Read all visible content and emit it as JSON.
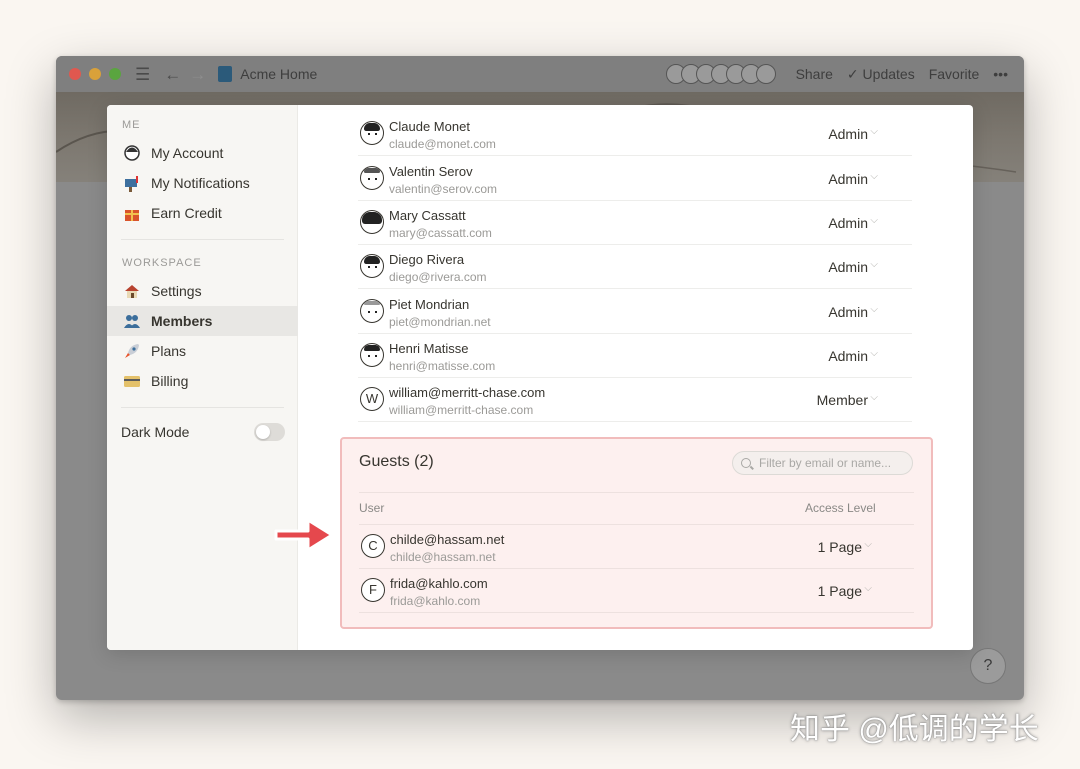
{
  "titlebar": {
    "page_title": "Acme Home",
    "share_label": "Share",
    "updates_label": "Updates",
    "favorite_label": "Favorite",
    "more_label": "•••"
  },
  "sidebar": {
    "me_label": "ME",
    "workspace_label": "WORKSPACE",
    "me_items": [
      {
        "label": "My Account",
        "icon": "account-icon"
      },
      {
        "label": "My Notifications",
        "icon": "mailbox-icon"
      },
      {
        "label": "Earn Credit",
        "icon": "gift-icon"
      }
    ],
    "workspace_items": [
      {
        "label": "Settings",
        "icon": "house-icon"
      },
      {
        "label": "Members",
        "icon": "people-icon",
        "active": true
      },
      {
        "label": "Plans",
        "icon": "rocket-icon"
      },
      {
        "label": "Billing",
        "icon": "credit-card-icon"
      }
    ],
    "dark_mode_label": "Dark Mode",
    "dark_mode_on": false
  },
  "members": [
    {
      "name": "Claude Monet",
      "email": "claude@monet.com",
      "role": "Admin"
    },
    {
      "name": "Valentin Serov",
      "email": "valentin@serov.com",
      "role": "Admin"
    },
    {
      "name": "Mary Cassatt",
      "email": "mary@cassatt.com",
      "role": "Admin"
    },
    {
      "name": "Diego Rivera",
      "email": "diego@rivera.com",
      "role": "Admin"
    },
    {
      "name": "Piet Mondrian",
      "email": "piet@mondrian.net",
      "role": "Admin"
    },
    {
      "name": "Henri Matisse",
      "email": "henri@matisse.com",
      "role": "Admin"
    },
    {
      "name": "william@merritt-chase.com",
      "email": "william@merritt-chase.com",
      "role": "Member",
      "initial": "W"
    }
  ],
  "guests": {
    "title": "Guests (2)",
    "filter_placeholder": "Filter by email or name...",
    "col_user": "User",
    "col_access": "Access Level",
    "rows": [
      {
        "name": "childe@hassam.net",
        "email": "childe@hassam.net",
        "access": "1 Page",
        "initial": "C"
      },
      {
        "name": "frida@kahlo.com",
        "email": "frida@kahlo.com",
        "access": "1 Page",
        "initial": "F"
      }
    ]
  },
  "help_label": "?",
  "watermark": "知乎 @低调的学长",
  "colors": {
    "highlight_border": "#f1bcbc",
    "highlight_bg": "#fdf0ef",
    "arrow": "#e5484d"
  }
}
